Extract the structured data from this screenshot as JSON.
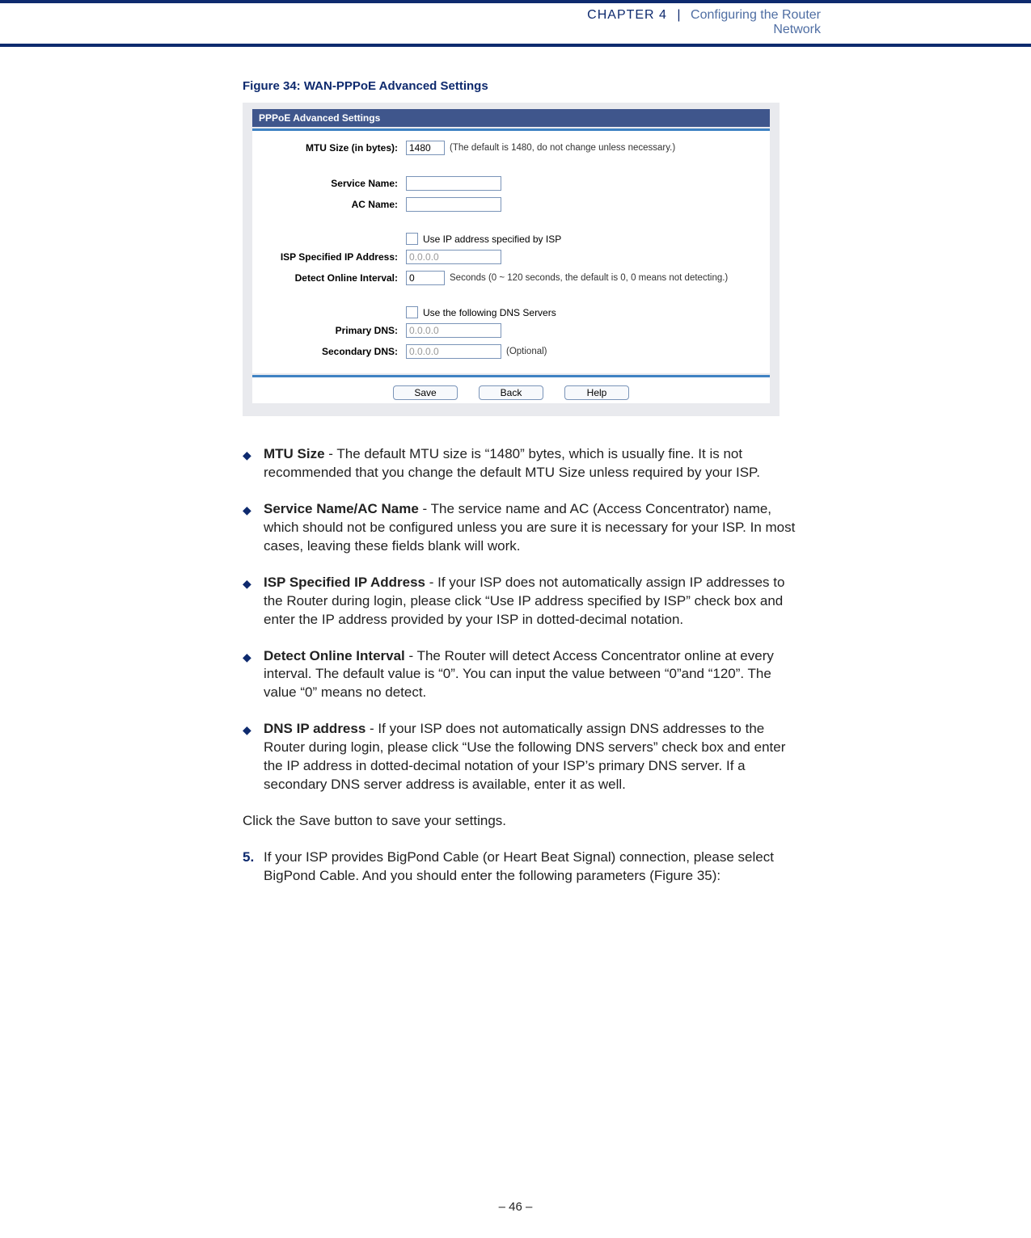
{
  "header": {
    "chapter_caps": "CHAPTER 4",
    "separator": "|",
    "title_line1": "Configuring the Router",
    "title_line2": "Network"
  },
  "figure_caption": "Figure 34:  WAN-PPPoE Advanced Settings",
  "panel": {
    "title": "PPPoE Advanced Settings",
    "mtu_label": "MTU Size (in bytes):",
    "mtu_value": "1480",
    "mtu_hint": "(The default is 1480, do not change unless necessary.)",
    "service_name_label": "Service Name:",
    "service_name_value": "",
    "ac_name_label": "AC Name:",
    "ac_name_value": "",
    "use_isp_ip_label": "Use IP address specified by ISP",
    "isp_ip_label": "ISP Specified IP Address:",
    "isp_ip_value": "0.0.0.0",
    "detect_label": "Detect Online Interval:",
    "detect_value": "0",
    "detect_hint": "Seconds (0 ~ 120 seconds, the default is 0, 0 means not detecting.)",
    "use_dns_label": "Use the following DNS Servers",
    "primary_dns_label": "Primary DNS:",
    "primary_dns_value": "0.0.0.0",
    "secondary_dns_label": "Secondary DNS:",
    "secondary_dns_value": "0.0.0.0",
    "secondary_dns_hint": "(Optional)",
    "btn_save": "Save",
    "btn_back": "Back",
    "btn_help": "Help"
  },
  "bullets": {
    "b1_title": "MTU Size",
    "b1_text": " - The default MTU size is “1480” bytes, which is usually fine. It is not recommended that you change the default MTU Size unless required by your ISP.",
    "b2_title": "Service Name/AC Name",
    "b2_text": " - The service name and AC (Access Concentrator) name, which should not be configured unless you are sure it is necessary for your ISP. In most cases, leaving these fields blank will work.",
    "b3_title": "ISP Specified IP Address",
    "b3_text": " - If your ISP does not automatically assign IP addresses to the   Router during login, please click “Use IP address specified by ISP” check box and enter the IP address provided by your ISP in dotted-decimal notation.",
    "b4_title": "Detect Online Interval",
    "b4_text": " - The Router will detect Access Concentrator online at every interval. The default value is “0”. You can input the value between “0”and “120”. The value “0” means no detect.",
    "b5_title": "DNS IP address",
    "b5_text": " - If your ISP does not automatically assign DNS addresses to the Router during login, please click “Use the following DNS servers” check box and enter the IP address in dotted-decimal notation of your ISP’s primary DNS server. If a secondary DNS server address is available, enter it as well."
  },
  "save_line": "Click the Save button to save your settings.",
  "step5_num": "5.",
  "step5_text": "If your ISP provides BigPond Cable (or Heart Beat Signal) connection, please select BigPond Cable. And you should enter the following parameters (Figure 35):",
  "page_number": "–  46  –"
}
